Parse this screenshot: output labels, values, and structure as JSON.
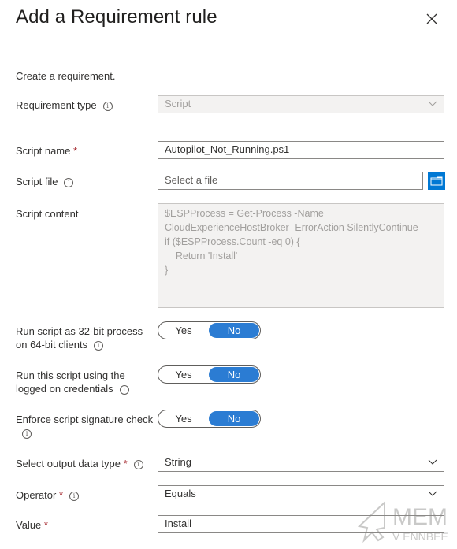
{
  "dialog": {
    "title": "Add a Requirement rule",
    "description": "Create a requirement."
  },
  "fields": {
    "requirement_type": {
      "label": "Requirement type",
      "value": "Script",
      "disabled": true
    },
    "script_name": {
      "label": "Script name",
      "required_mark": "*",
      "value": "Autopilot_Not_Running.ps1"
    },
    "script_file": {
      "label": "Script file",
      "placeholder": "Select a file"
    },
    "script_content": {
      "label": "Script content",
      "value": "$ESPProcess = Get-Process -Name\nCloudExperienceHostBroker -ErrorAction SilentlyContinue\nif ($ESPProcess.Count -eq 0) {\n    Return 'Install'\n}"
    },
    "run_32bit": {
      "label_line1": "Run script as 32-bit process",
      "label_line2": "on 64-bit clients",
      "yes": "Yes",
      "no": "No",
      "selected": "No"
    },
    "logged_on_credentials": {
      "label_line1": "Run this script using the",
      "label_line2": "logged on credentials",
      "yes": "Yes",
      "no": "No",
      "selected": "No"
    },
    "signature_check": {
      "label_line1": "Enforce script signature check",
      "yes": "Yes",
      "no": "No",
      "selected": "No"
    },
    "output_data_type": {
      "label": "Select output data type",
      "required_mark": "*",
      "value": "String"
    },
    "operator": {
      "label": "Operator",
      "required_mark": "*",
      "value": "Equals"
    },
    "value": {
      "label": "Value",
      "required_mark": "*",
      "value": "Install"
    }
  },
  "icons": {
    "info": "i",
    "close": "close-icon",
    "browse": "folder-icon",
    "dropdown": "chevron-down-icon"
  },
  "watermark": {
    "line1": "MEM",
    "line2": "V ENNBEE"
  },
  "colors": {
    "accent": "#0078d4",
    "toggle_on": "#2b7cd3",
    "required": "#a4262c"
  }
}
